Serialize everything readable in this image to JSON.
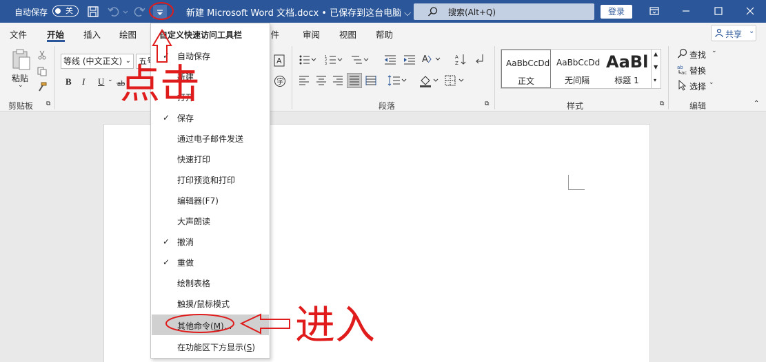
{
  "titlebar": {
    "autosave_label": "自动保存",
    "autosave_state": "关",
    "document_title": "新建 Microsoft Word 文档.docx • 已保存到这台电脑 ⌵",
    "search_placeholder": "搜索(Alt+Q)",
    "login_label": "登录"
  },
  "tabs": [
    "文件",
    "开始",
    "插入",
    "绘图",
    "邮件",
    "审阅",
    "视图",
    "帮助"
  ],
  "active_tab": "开始",
  "share_label": "共享",
  "ribbon": {
    "paste_label": "粘贴",
    "clipboard_group": "剪贴板",
    "font_name": "等线 (中文正文)",
    "font_size": "五号",
    "bold": "B",
    "italic": "I",
    "underline": "U",
    "paragraph_group": "段落",
    "styles_group": "样式",
    "styles": [
      {
        "sample": "AaBbCcDd",
        "name": "正文"
      },
      {
        "sample": "AaBbCcDd",
        "name": "无间隔"
      },
      {
        "sample": "AaBl",
        "name": "标题 1"
      }
    ],
    "find_label": "查找",
    "replace_label": "替换",
    "select_label": "选择",
    "editing_group": "编辑"
  },
  "qat_menu": {
    "header": "自定义快速访问工具栏",
    "items": [
      {
        "label": "自动保存",
        "checked": true
      },
      {
        "label": "新建",
        "checked": false
      },
      {
        "label": "打开",
        "checked": false
      },
      {
        "label": "保存",
        "checked": true
      },
      {
        "label": "通过电子邮件发送",
        "checked": false
      },
      {
        "label": "快速打印",
        "checked": false
      },
      {
        "label": "打印预览和打印",
        "checked": false
      },
      {
        "label": "编辑器(F7)",
        "checked": false
      },
      {
        "label": "大声朗读",
        "checked": false
      },
      {
        "label": "撤消",
        "checked": true
      },
      {
        "label": "重做",
        "checked": true
      },
      {
        "label": "绘制表格",
        "checked": false
      },
      {
        "label": "触摸/鼠标模式",
        "checked": false
      }
    ],
    "more_commands": {
      "label": "其他命令(",
      "accel": "M",
      "suffix": ")..."
    },
    "show_below": {
      "label": "在功能区下方显示(",
      "accel": "S",
      "suffix": ")"
    }
  },
  "annotations": {
    "click": "点击",
    "enter": "进入"
  },
  "colors": {
    "titlebar": "#2b579a",
    "annotation": "#e01b1b",
    "menu_hover": "#d0d0d0"
  }
}
